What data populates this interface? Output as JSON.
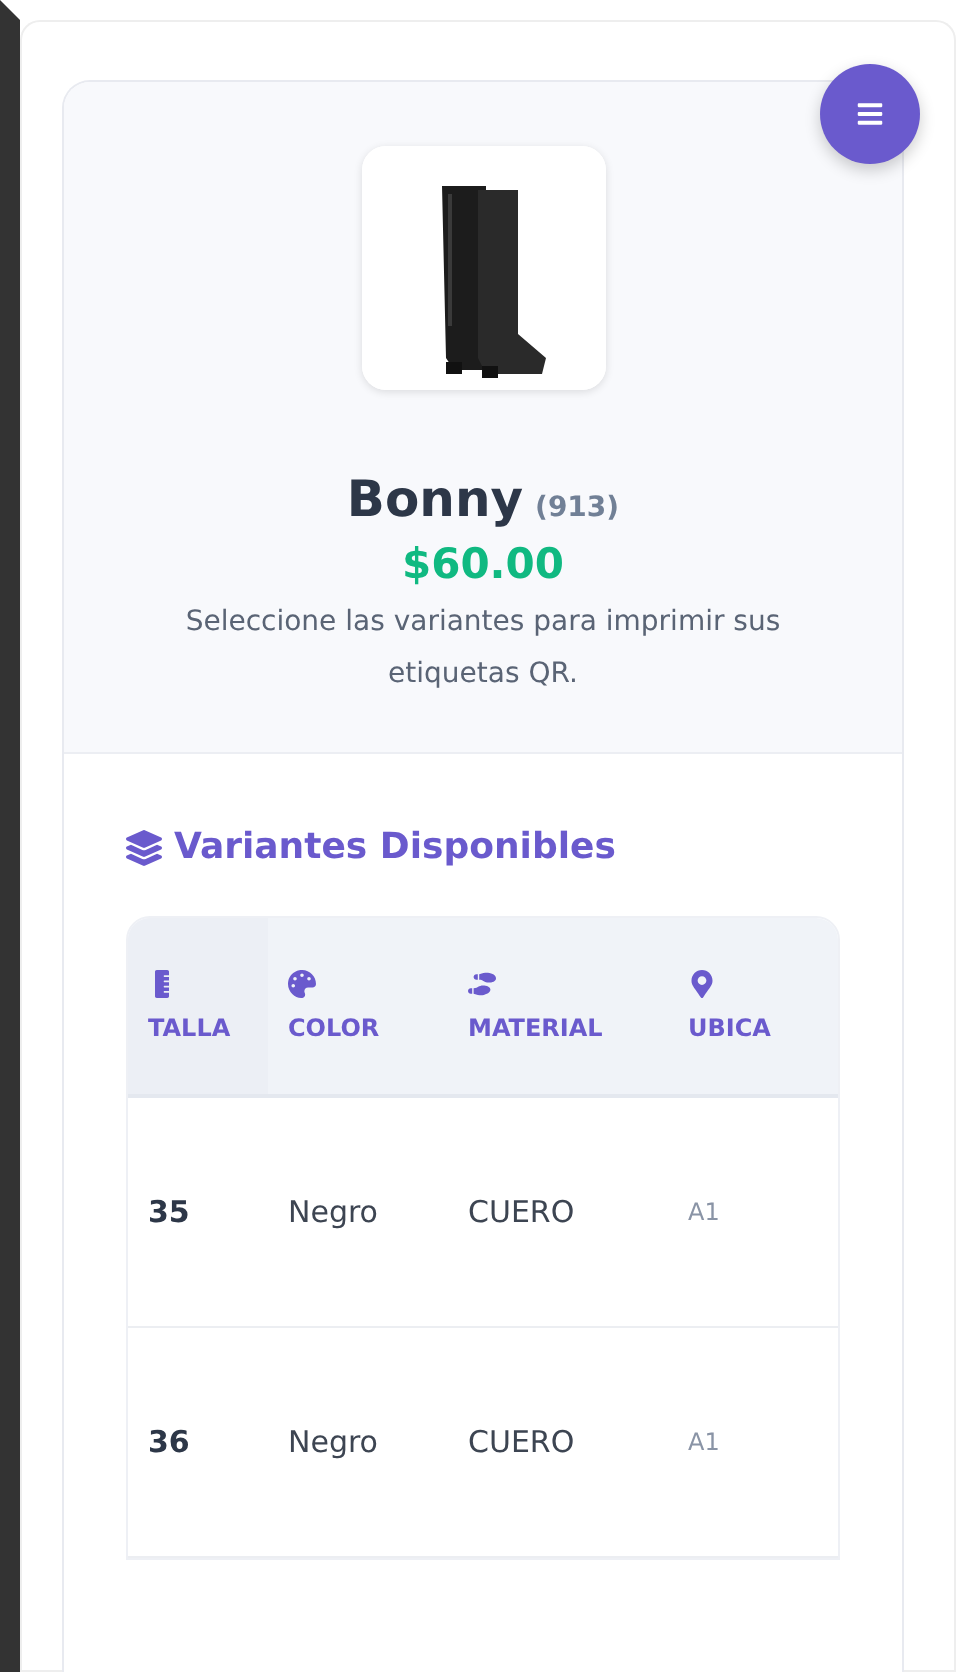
{
  "product": {
    "name": "Bonny",
    "code": "(913)",
    "price": "$60.00",
    "hint": "Seleccione las variantes para imprimir sus etiquetas QR."
  },
  "section_title": "Variantes Disponibles",
  "table": {
    "columns": [
      {
        "label": "TALLA"
      },
      {
        "label": "COLOR"
      },
      {
        "label": "MATERIAL"
      },
      {
        "label": "UBICA"
      }
    ],
    "rows": [
      {
        "cells": [
          "35",
          "Negro",
          "CUERO",
          "A1"
        ]
      },
      {
        "cells": [
          "36",
          "Negro",
          "CUERO",
          "A1"
        ]
      }
    ]
  }
}
